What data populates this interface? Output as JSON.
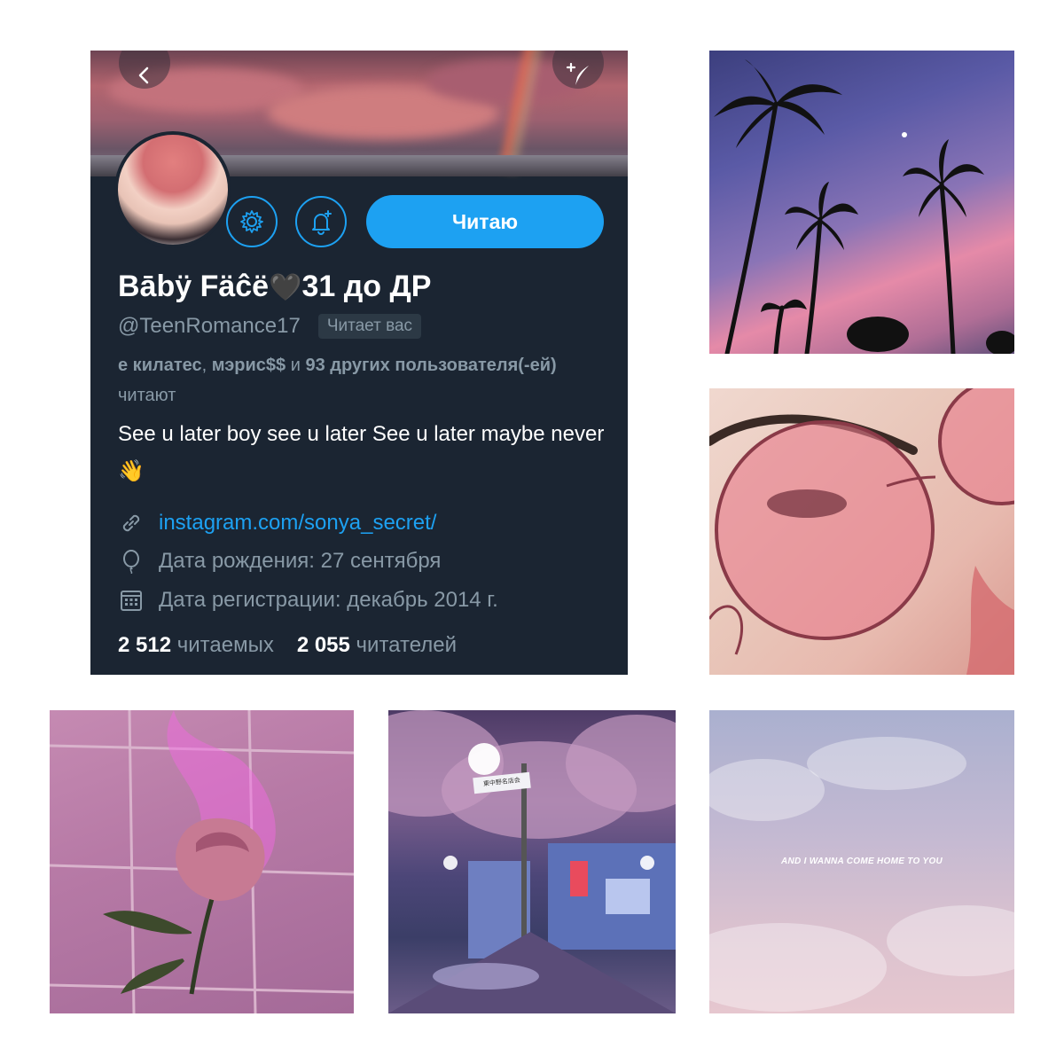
{
  "profile": {
    "follow_button_label": "Читаю",
    "display_name": "Bābÿ Fäĉë",
    "name_emoji": "🖤",
    "name_suffix": "31 до ДР",
    "handle": "@TeenRomance17",
    "follows_you_badge": "Читает вас",
    "followed_by": {
      "name1": "е килатес",
      "sep1": ", ",
      "name2": "мэрис$$",
      "sep2": " и ",
      "others": "93 других пользователя(-ей)",
      "suffix": " читают"
    },
    "bio": "See u later boy see u later See u later maybe never",
    "bio_emoji": "👋",
    "website": "instagram.com/sonya_secret/",
    "birthday": "Дата рождения: 27 сентября",
    "joined": "Дата регистрации: декабрь 2014 г.",
    "following_count": "2 512",
    "following_label": "читаемых",
    "followers_count": "2 055",
    "followers_label": "читателей"
  },
  "tiles": {
    "sky_quote": "AND I WANNA COME HOME TO YOU",
    "street_sign": "東中野名店会"
  },
  "icons": {
    "back": "chevron-left-icon",
    "compose": "compose-feather-icon",
    "settings": "gear-icon",
    "notify": "bell-plus-icon",
    "link": "link-icon",
    "birthday": "balloon-icon",
    "joined": "calendar-icon"
  },
  "colors": {
    "card_background": "#1b2532",
    "accent": "#1da1f2",
    "secondary_text": "#8899a6"
  }
}
